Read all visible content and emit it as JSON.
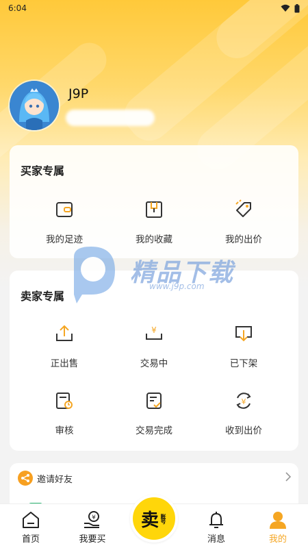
{
  "status_bar": {
    "time": "6:04"
  },
  "profile": {
    "username": "J9P"
  },
  "buyer_section": {
    "title": "买家专属",
    "items": [
      {
        "label": "我的足迹",
        "icon": "footprint-icon"
      },
      {
        "label": "我的收藏",
        "icon": "collection-icon"
      },
      {
        "label": "我的出价",
        "icon": "price-tag-icon"
      }
    ]
  },
  "seller_section": {
    "title": "卖家专属",
    "items": [
      {
        "label": "正出售",
        "icon": "upload-icon"
      },
      {
        "label": "交易中",
        "icon": "trading-icon"
      },
      {
        "label": "已下架",
        "icon": "delisted-icon"
      },
      {
        "label": "审核",
        "icon": "review-icon"
      },
      {
        "label": "交易完成",
        "icon": "completed-icon"
      },
      {
        "label": "收到出价",
        "icon": "received-offer-icon"
      }
    ]
  },
  "invite": {
    "label": "邀请好友"
  },
  "watermark": {
    "brand": "精品下载",
    "url": "www.j9p.com"
  },
  "bottom_nav": {
    "items": [
      {
        "label": "首页",
        "icon": "home-icon"
      },
      {
        "label": "我要买",
        "icon": "buy-icon"
      },
      {
        "label": "消息",
        "icon": "bell-icon"
      },
      {
        "label": "我的",
        "icon": "profile-icon"
      }
    ],
    "sell": {
      "main": "卖",
      "sub": "账号"
    },
    "active_color": "#f5a623"
  },
  "colors": {
    "accent": "#ffc93a",
    "sell_button": "#ffd60a",
    "invite_icon": "#f7a021"
  }
}
